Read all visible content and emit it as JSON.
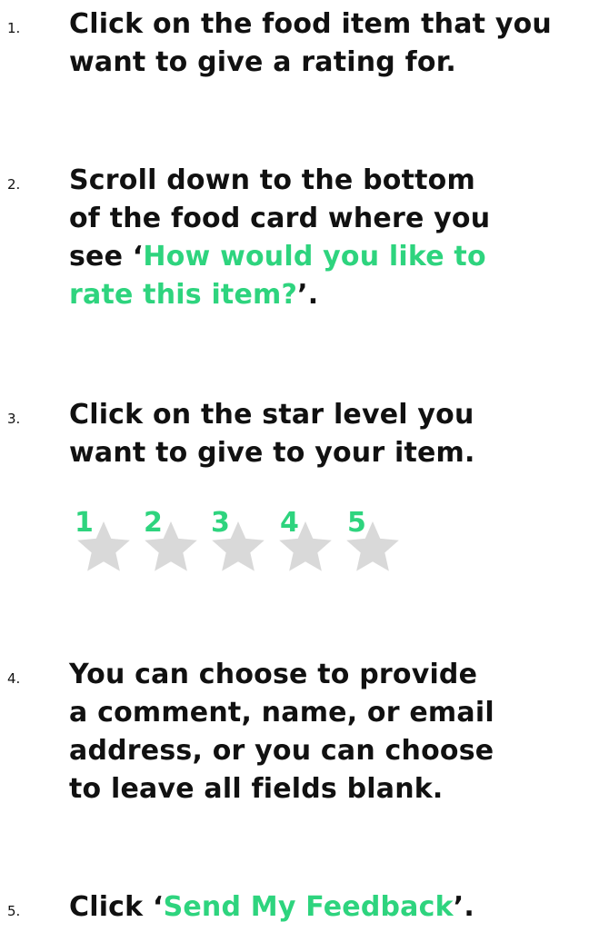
{
  "steps": [
    {
      "number": "1.",
      "lines": [
        "Click on the food item that you",
        "want to give a rating for."
      ]
    },
    {
      "number": "2.",
      "line1": "Scroll down to the bottom",
      "line2": "of the food card where you",
      "line3_prefix": "see ‘",
      "line3_accent": "How would you like to",
      "line4_accent": "rate this item?",
      "line4_suffix": "’."
    },
    {
      "number": "3.",
      "lines": [
        "Click on the star level you",
        "want to give to your item."
      ],
      "stars": [
        "1",
        "2",
        "3",
        "4",
        "5"
      ]
    },
    {
      "number": "4.",
      "lines": [
        "You can choose to provide",
        "a comment, name, or email",
        "address, or you can choose",
        "to leave all fields blank."
      ]
    },
    {
      "number": "5.",
      "prefix": "Click ‘",
      "accent": "Send My Feedback",
      "suffix": "’."
    }
  ],
  "colors": {
    "accent": "#2ed47e",
    "star": "#d9d9d9",
    "text": "#111111"
  }
}
